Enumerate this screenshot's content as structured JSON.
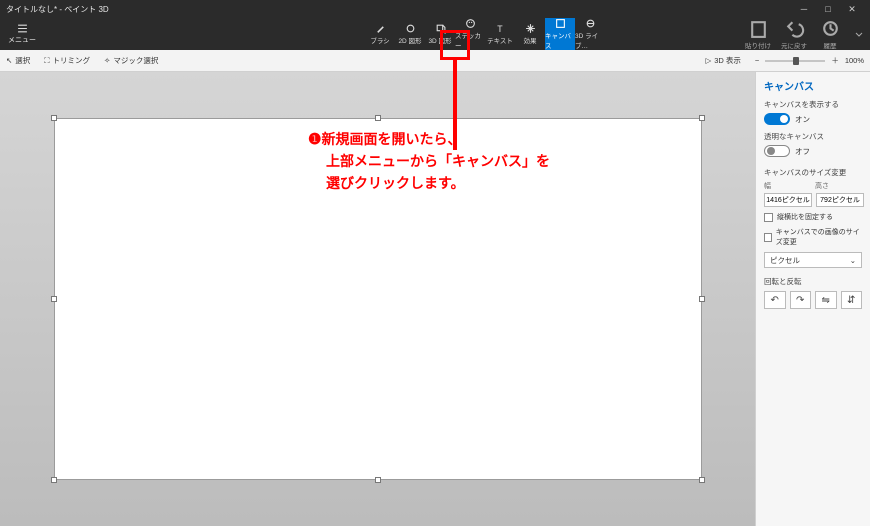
{
  "title": "タイトルなし* - ペイント 3D",
  "window": {
    "min": "─",
    "max": "□",
    "close": "✕"
  },
  "menu_label": "メニュー",
  "tools": [
    {
      "label": "ブラシ"
    },
    {
      "label": "2D 図形"
    },
    {
      "label": "3D 図形"
    },
    {
      "label": "ステッカー"
    },
    {
      "label": "テキスト"
    },
    {
      "label": "効果"
    },
    {
      "label": "キャンバス",
      "active": true
    },
    {
      "label": "3D ライブ…"
    }
  ],
  "right_ribbon": {
    "paste": "貼り付け",
    "undo": "元に戻す",
    "history": "履歴"
  },
  "toolbar": {
    "select": "選択",
    "trimming": "トリミング",
    "magic": "マジック選択",
    "view3d": "3D 表示",
    "zoom_minus": "−",
    "zoom_plus": "＋",
    "zoom_value": "100%"
  },
  "panel": {
    "title": "キャンバス",
    "show_canvas_label": "キャンバスを表示する",
    "show_canvas_state": "オン",
    "transparent_label": "透明なキャンバス",
    "transparent_state": "オフ",
    "resize_label": "キャンバスのサイズ変更",
    "width_label": "幅",
    "height_label": "高さ",
    "width_value": "1416ピクセル",
    "height_value": "792ピクセル",
    "lock_aspect": "縦横比を固定する",
    "resize_image": "キャンバスでの画像のサイズ変更",
    "unit": "ピクセル",
    "rotate_label": "回転と反転",
    "rot": {
      "ccw": "↶",
      "cw": "↷",
      "fliph": "⇋",
      "flipv": "⇵"
    }
  },
  "annotation": {
    "num": "❶",
    "line1": "新規画面を開いたら、",
    "line2": "上部メニューから「キャンバス」を",
    "line3": "選びクリックします。"
  }
}
